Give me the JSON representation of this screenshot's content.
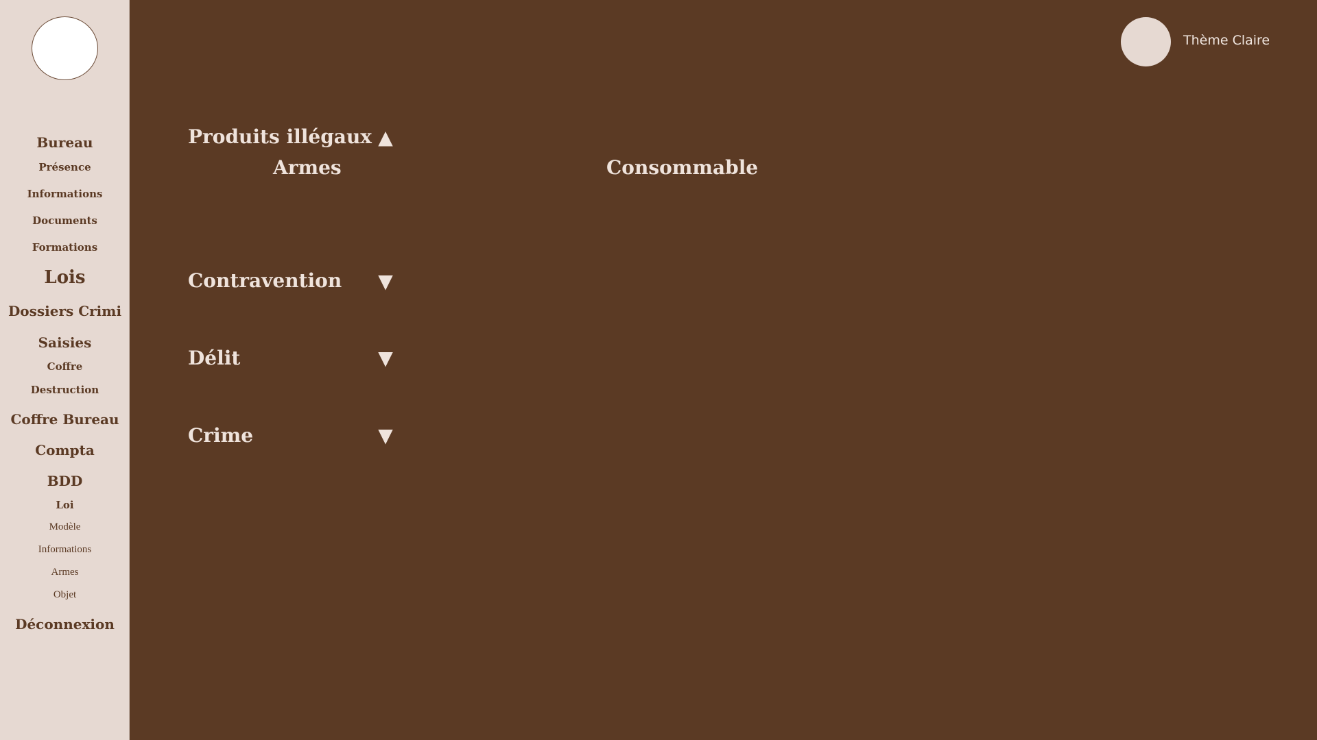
{
  "sidebar": {
    "items": [
      {
        "label": "Bureau"
      },
      {
        "label": "Présence"
      },
      {
        "label": "Informations"
      },
      {
        "label": "Documents"
      },
      {
        "label": "Formations"
      },
      {
        "label": "Lois"
      },
      {
        "label": "Dossiers Crimi"
      },
      {
        "label": "Saisies"
      },
      {
        "label": "Coffre"
      },
      {
        "label": "Destruction"
      },
      {
        "label": "Coffre Bureau"
      },
      {
        "label": "Compta"
      },
      {
        "label": "BDD"
      },
      {
        "label": "Loi"
      },
      {
        "label": "Modèle"
      },
      {
        "label": "Informations"
      },
      {
        "label": "Armes"
      },
      {
        "label": "Objet"
      },
      {
        "label": "Déconnexion"
      }
    ]
  },
  "header": {
    "theme_label": "Thème Claire"
  },
  "sections": [
    {
      "title": "Produits illégaux",
      "arrow": "▲",
      "state": "expanded",
      "subcategories": [
        "Armes",
        "Consommable"
      ]
    },
    {
      "title": "Contravention",
      "arrow": "▼",
      "state": "collapsed"
    },
    {
      "title": "Délit",
      "arrow": "▼",
      "state": "collapsed"
    },
    {
      "title": "Crime",
      "arrow": "▼",
      "state": "collapsed"
    }
  ],
  "colors": {
    "background": "#5b3a24",
    "sidebar": "#e6d9d2",
    "text_light": "#efe3dc",
    "text_dark": "#5b3a24"
  },
  "icons": {
    "expand": "triangle-down-icon",
    "collapse": "triangle-up-icon"
  }
}
